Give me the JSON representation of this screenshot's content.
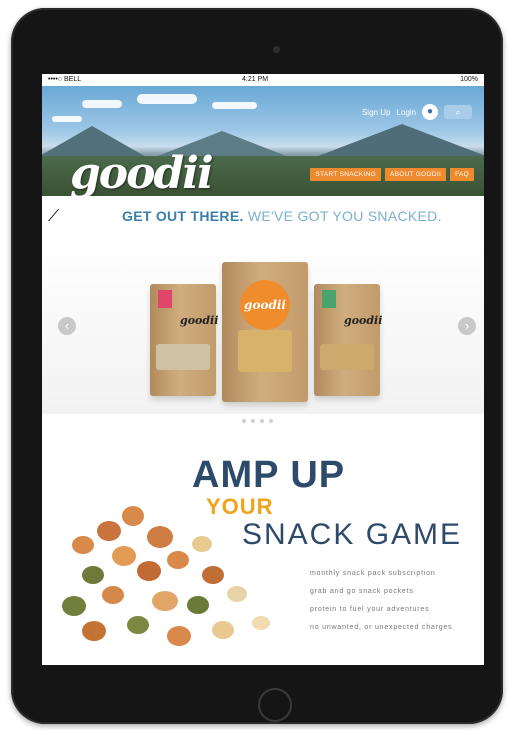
{
  "status_bar": {
    "carrier": "••••○ BELL",
    "time": "4:21 PM",
    "battery": "100%"
  },
  "header": {
    "signup_label": "Sign Up",
    "login_label": "Login",
    "search_icon": "search-icon",
    "logo_text": "goodii"
  },
  "nav": {
    "items": [
      "START SNACKING",
      "ABOUT GOODII",
      "FAQ"
    ]
  },
  "hero": {
    "tagline_strong": "GET OUT THERE.",
    "tagline_light": "WE'VE GOT YOU SNACKED."
  },
  "carousel": {
    "products": [
      {
        "brand": "goodii",
        "tag_color": "#e0456a"
      },
      {
        "brand": "goodii",
        "tag_color": "#ef8c2c"
      },
      {
        "brand": "goodii",
        "tag_color": "#4aa36a"
      }
    ],
    "slide_count": 4
  },
  "promo": {
    "line1": "AMP UP",
    "line2": "YOUR",
    "line3": "SNACK GAME",
    "features": [
      "monthly snack pack subscription",
      "grab and go snack pockets",
      "protein to fuel your adventures",
      "no unwanted, or unexpected charges"
    ]
  },
  "colors": {
    "accent_orange": "#ee8a2e",
    "navy": "#2e4a6a",
    "gold": "#f0a31d",
    "blue": "#3b7fa8"
  }
}
